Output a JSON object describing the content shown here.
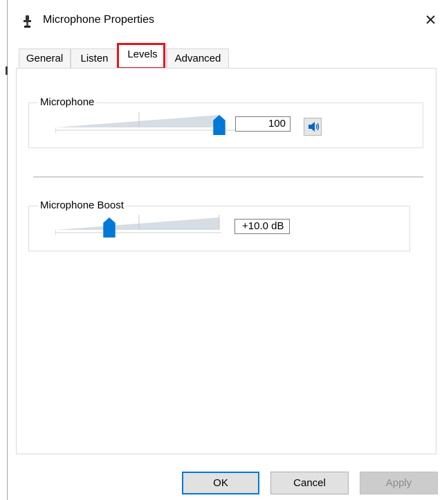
{
  "window": {
    "title": "Microphone Properties",
    "title_icon": "microphone-icon",
    "close_glyph": "✕"
  },
  "tabs": [
    {
      "label": "General"
    },
    {
      "label": "Listen"
    },
    {
      "label": "Levels",
      "selected": true
    },
    {
      "label": "Advanced"
    }
  ],
  "levels": {
    "microphone": {
      "label": "Microphone",
      "value": "100",
      "level_percent": 100,
      "mute_icon": "speaker-icon"
    },
    "boost": {
      "label": "Microphone Boost",
      "value": "+10.0 dB",
      "level_fraction": 0.33
    }
  },
  "footer": {
    "ok_label": "OK",
    "cancel_label": "Cancel",
    "apply_label": "Apply"
  },
  "colors": {
    "accent": "#0078d7",
    "highlight": "#e8141b"
  }
}
